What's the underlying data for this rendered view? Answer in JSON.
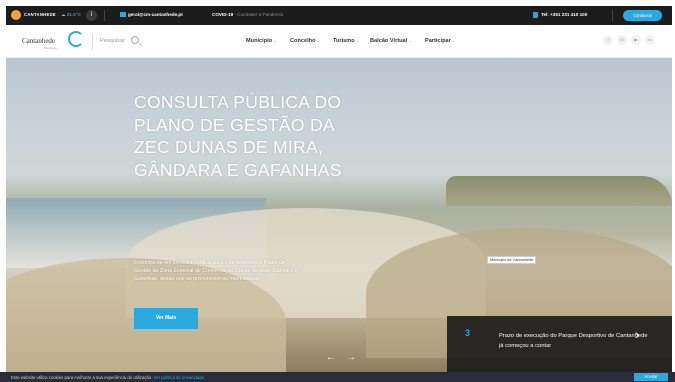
{
  "topbar": {
    "city": "CANTANHEDE",
    "weather": "☁ 21.5°C",
    "info_icon": "info-icon",
    "email": "geral@cm-cantanhede.pt",
    "covid_label": "COVID-19",
    "covid_text": " - Combater a Pandemia",
    "phone": "Tel: +351 231 410 100",
    "contact_button": "Contactos"
  },
  "header": {
    "logo_text": "Cantanhede",
    "logo_sub": "Município",
    "search_label": "Pesquisar",
    "menu": [
      "Município",
      "Concelho",
      "Turismo",
      "Balcão Virtual",
      "Participar"
    ],
    "social": [
      "f",
      "◎",
      "▶",
      "in"
    ]
  },
  "hero": {
    "title": "CONSULTA PÚBLICA DO PLANO DE GESTÃO DA ZEC DUNAS DE MIRA, GÂNDARA E GAFANHAS",
    "subtitle": "Encontra-se em consulta pública até 17 de setembro o Plano de Gestão da Zona Especial de Conservação Dunas de Mira, Gândara e Gafanhas, desde que se pronunciem os interessados.",
    "button": "Ver Mais",
    "tooltip": "Município de Cantanhede",
    "prev_icon": "←",
    "next_icon": "→"
  },
  "news": {
    "number": "3",
    "text": "Prazo de execução do Parque Desportivo de Cantanhede já começou a contar",
    "arrow": "›"
  },
  "cookie": {
    "text": "Este website utiliza cookies para melhorar a sua experiência de utilização. ",
    "link": "Ver política de privacidade",
    "accept": "Aceitar"
  },
  "colors": {
    "accent": "#2aa9e0",
    "topbar": "#1c1c1c",
    "cookie_bar": "#2b2b3a"
  }
}
